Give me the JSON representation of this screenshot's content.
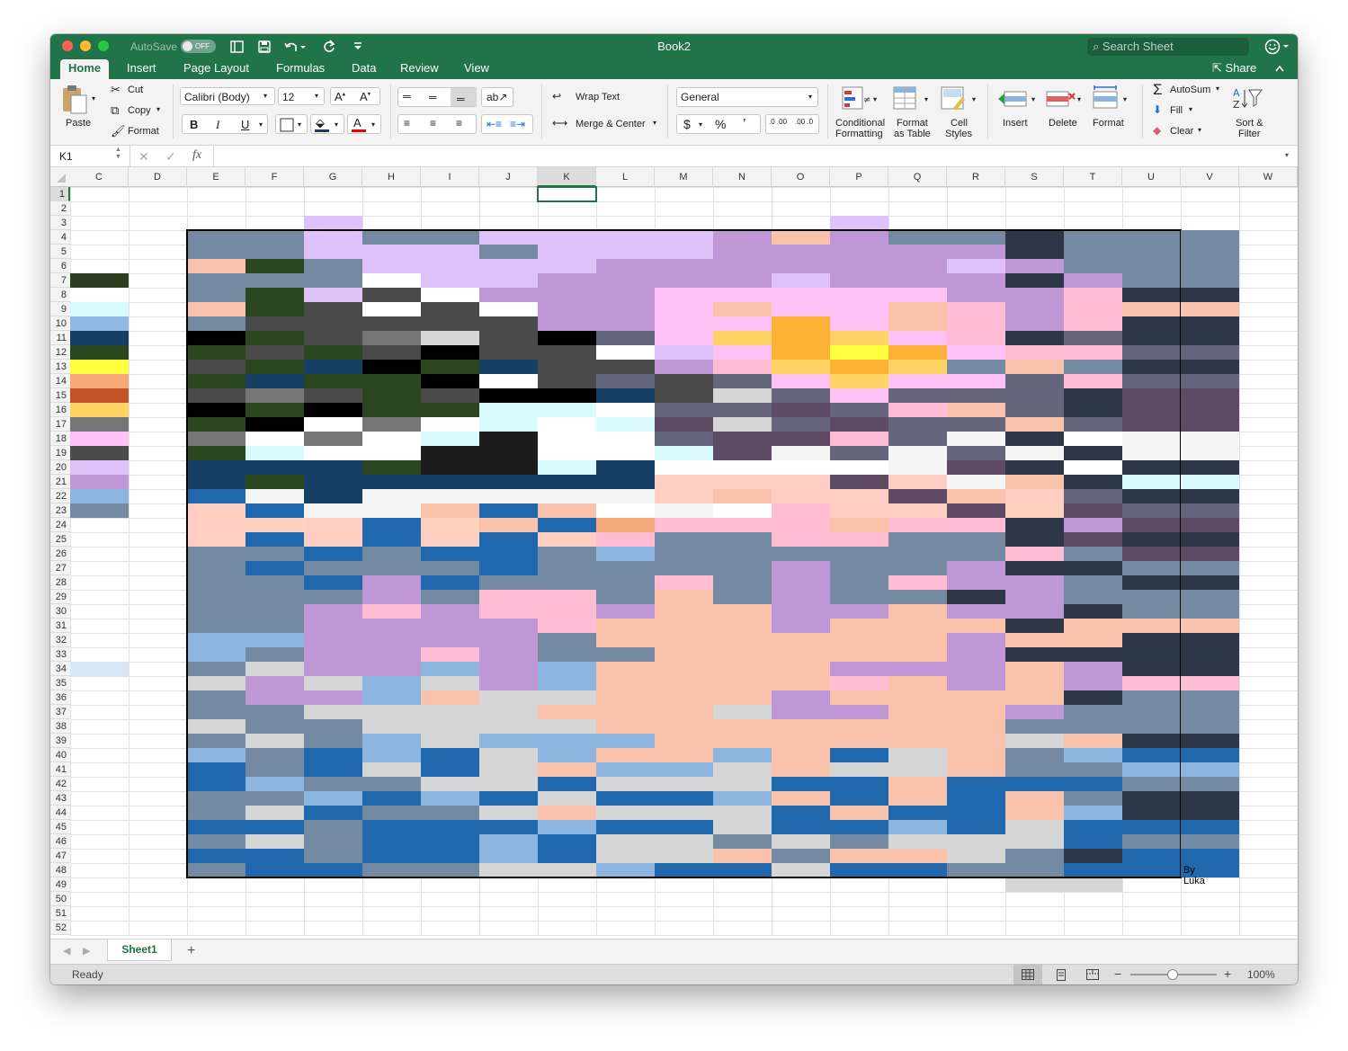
{
  "window": {
    "title": "Book2",
    "autosave_label": "AutoSave",
    "autosave_state": "OFF",
    "search_placeholder": "Search Sheet",
    "share_label": "Share"
  },
  "tabs": [
    "Home",
    "Insert",
    "Page Layout",
    "Formulas",
    "Data",
    "Review",
    "View"
  ],
  "active_tab": "Home",
  "ribbon": {
    "paste": "Paste",
    "cut": "Cut",
    "copy": "Copy",
    "format_painter": "Format",
    "font_name": "Calibri (Body)",
    "font_size": "12",
    "bold": "B",
    "italic": "I",
    "underline": "U",
    "wrap_text": "Wrap Text",
    "merge_center": "Merge & Center",
    "number_format": "General",
    "currency": "$",
    "percent": "%",
    "comma": "’",
    "dec_inc": ".0 .00",
    "dec_dec": ".00 .0",
    "cond_format_1": "Conditional",
    "cond_format_2": "Formatting",
    "format_table_1": "Format",
    "format_table_2": "as Table",
    "cell_styles_1": "Cell",
    "cell_styles_2": "Styles",
    "insert": "Insert",
    "delete": "Delete",
    "format": "Format",
    "autosum": "AutoSum",
    "fill": "Fill",
    "clear": "Clear",
    "sort_filter_1": "Sort &",
    "sort_filter_2": "Filter"
  },
  "formula_bar": {
    "name_box": "K1",
    "fx": "fx",
    "value": ""
  },
  "sheet": {
    "columns": [
      "C",
      "D",
      "E",
      "F",
      "G",
      "H",
      "I",
      "J",
      "K",
      "L",
      "M",
      "N",
      "O",
      "P",
      "Q",
      "R",
      "S",
      "T",
      "U",
      "V",
      "W"
    ],
    "selected_column": "K",
    "selected_row": 1,
    "signature_text": "By Luka",
    "palette": {
      "A": "#2b3d1f",
      "B": "#ffffff",
      "c": "#d9fbff",
      "D": "#8fb9e0",
      "E": "#163f66",
      "F": "#2a461e",
      "G": "#ffff3d",
      "H": "#f6a87a",
      "I": "#c5532a",
      "J": "#ffd465",
      "K": "#767676",
      "L": "#ffc2f6",
      "M": "#4a4a4a",
      "N": "#e0c2fb",
      "O": "#bf97d6",
      "P": "#8cb5df",
      "Q": "#7489a2",
      "R": "#fbc2ab",
      "S": "#2d3748",
      "T": "#1f68ae",
      "U": "#d6d6d6",
      "V": "#000000",
      "W": "#1c1c1c",
      "X": "#5e4a64",
      "Y": "#65657e",
      "Z": "#ffbcd2",
      "a": "#fbb236",
      "b": "#ffcdc2",
      "d": "#f5f5f5",
      "e": "#d8e7f5",
      "f": "#fdd2be"
    },
    "col_c_swatches": [
      "A",
      "B",
      "c",
      "D",
      "E",
      "F",
      "G",
      "H",
      "I",
      "J",
      "K",
      "L",
      "M",
      "N",
      "O",
      "P",
      "Q"
    ],
    "painting_rows": [
      "QQNQQNNNNOROQQSQQ",
      "QQNNNQNNNOOOOOSQQ",
      "RFQNNNNOOOOOONOQQ",
      "QQQBNNOOOONOOOSOQ",
      "QFNMBOOOLLLLLOOZS",
      "RFMBMBOOLRLLRZOZR",
      "QMMMMMOOLLaLRZOZS",
      "VFMKUMVYLJaJLZSYS",
      "FMFMVMMBNLaGaLZZY",
      "MFEVFEMMOZJaJQRQS",
      "FEFFVBMYMYLJLLYZY",
      "MKMFMVVEMUYLYYYSX",
      "VFVFFccBYYXYZRYSX",
      "FVBKBcBcXUYXYYRYX",
      "KBKBcWBBYXXZYdSBd",
      "FcBBWWBBcXdYdYdSd",
      "EEEFWWcEBBBBdXSBS",
      "EFEEEEEEbbbXbdRSc",
      "TdEdddddbRbbXRbYS",
      "bTddRTRBdBZbbXfXY",
      "bfbTfRTHZZZRZZSOX",
      "bTbTbTbZQQZZQQSXS",
      "QQTQTTQPQQQQQQZQX",
      "QTQQQTQQQQOQQOSSQ",
      "QQTOTQQQZQOQZOOQS",
      "QQQOQZZQRQOQQSOQQ",
      "QQOZOZZORROOROOSQ",
      "QQOOOOZRRRORRRSRR",
      "PPOOOOQRRRRRRORRS",
      "PQOOZOQQRRRRROSSS",
      "QUOOPOPRRRROOOROS",
      "UOUPUOPRRRRZROROZ",
      "QOOPRUURRRORRRRSQ",
      "QQUUUURRRUOORROQQ",
      "UQQUUUURRRRRRRQQQ",
      "QUQPUPPPRRRRRRURS",
      "PQTPTUPRRPRTURQPT",
      "TQTUTURPPURUURQQP",
      "TPQQUUTUUUTTRTTTQ",
      "QQPTPTUTTPRTRTRQS",
      "QUTQQURUUUTRTTRPS",
      "TTQTTTPTTUTTPTUTT",
      "QUQTTPTUUQUQUUUTQ",
      "TTQTTPTUURQRRUQST",
      "QTTQQUUPTTUTTQQTT"
    ]
  }
}
